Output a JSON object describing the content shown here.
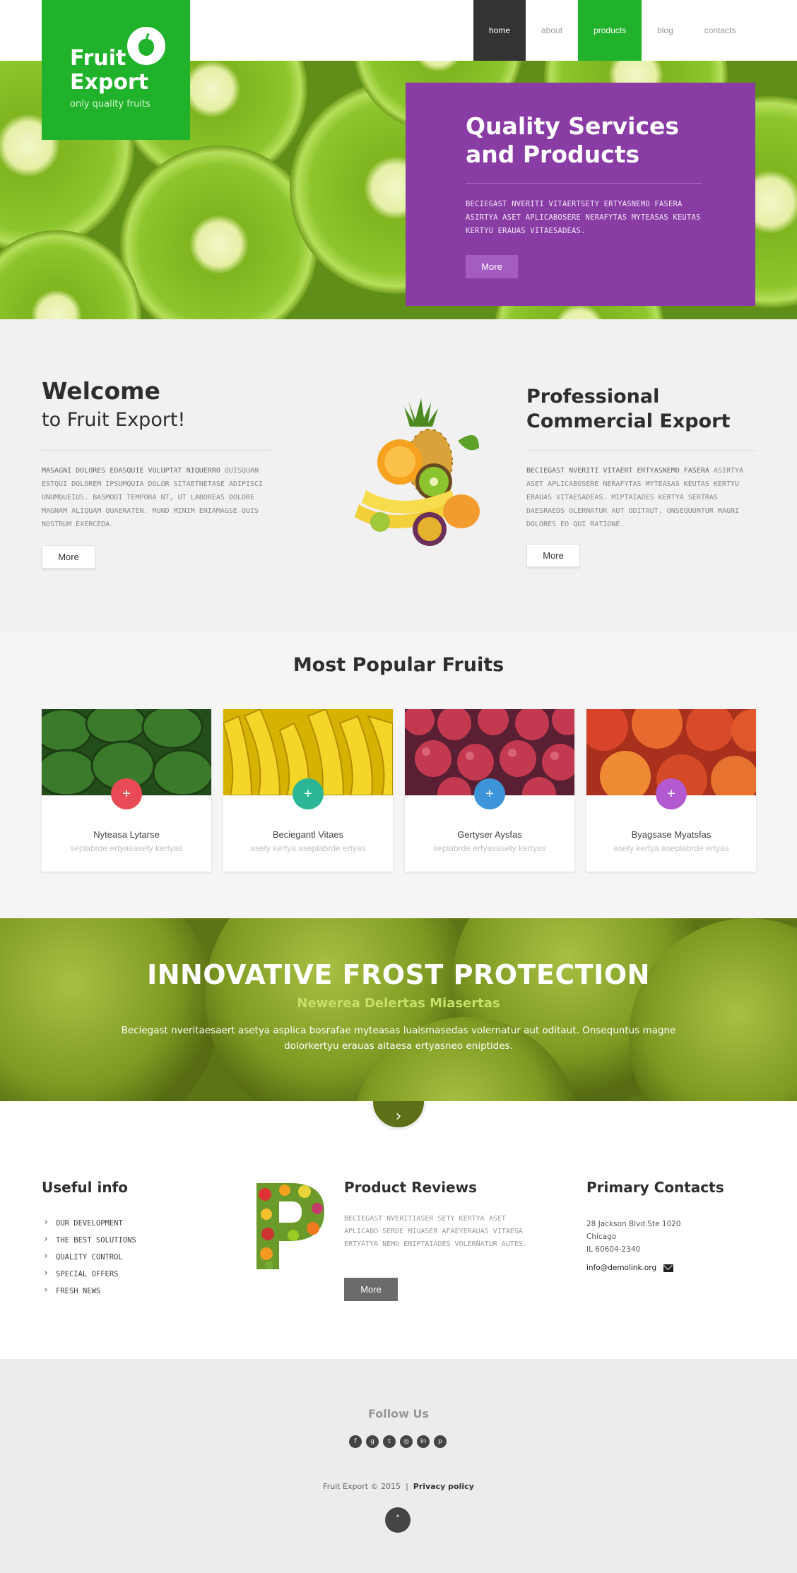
{
  "header": {
    "logo_line1": "Fruit",
    "logo_line2": "Export",
    "logo_tagline": "only quality fruits",
    "nav": [
      "home",
      "about",
      "products",
      "blog",
      "contacts"
    ]
  },
  "hero": {
    "title_line1": "Quality Services",
    "title_line2": "and Products",
    "text": "BECIEGAST NVERITI VITAERTSETY ERTYASNEMO FASERA ASIRTYA ASET APLICABOSERE NERAFYTAS MYTEASAS KEUTAS KERTYU ERAUAS VITAESADEAS.",
    "button": "More"
  },
  "welcome": {
    "title_line1": "Welcome",
    "title_line2": "to Fruit Export!",
    "text_first": "MASAGNI DOLORES EOASQUIE VOLUPTAT NIQUERRO",
    "text_rest": "QUISQUAN ESTQUI DOLOREM IPSUMQUIA DOLOR SITAETNETASE ADIPISCI UNUMQUEIUS. BASMODI TEMPORA NT, UT LABOREAS DOLORE MAGNAM ALIQUAM QUAERATEN. MUND MINIM ENIAMAGSE QUIS NOSTRUM EXERCEDA.",
    "button": "More"
  },
  "professional": {
    "title_line1": "Professional",
    "title_line2": "Commercial Export",
    "text_first": "BECIEGAST NVERITI VITAERT ERTYASNEMO FASERA",
    "text_rest": "ASIRTYA ASET APLICABOSERE NERAFYTAS MYTEASAS KEUTAS KERTYU ERAUAS VITAESADEAS. MIPTAIADES KERTYA SERTRAS DAESRAEDS OLERNATUR AUT ODITAUT. ONSEQUUNTUR MAGNI DOLORES EO QUI RATIONE.",
    "button": "More"
  },
  "popular": {
    "title": "Most Popular Fruits",
    "cards": [
      {
        "name": "Nyteasa Lytarse",
        "sub": "seplabrde ertyasasety kertyas",
        "color": "#e84b55",
        "icon": "plus-icon"
      },
      {
        "name": "Beciegantl Vitaes",
        "sub": "asety kertya aseplabrde ertyas",
        "color": "#2bb796",
        "icon": "plus-icon"
      },
      {
        "name": "Gertyser Aysfas",
        "sub": "seplabrde ertyasasety kertyas",
        "color": "#3d94d8",
        "icon": "plus-icon"
      },
      {
        "name": "Byagsase Myatsfas",
        "sub": "asety kertya aseplabrde ertyas",
        "color": "#b45ad0",
        "icon": "plus-icon"
      }
    ]
  },
  "frost": {
    "title": "INNOVATIVE FROST PROTECTION",
    "subtitle": "Newerea Delertas Miasertas",
    "text": "Beciegast nveritaesaert asetya asplica bosrafae myteasas luaismasedas volernatur aut oditaut. Onsequntus magne dolorkertyu erauas aitaesa ertyasneo eniptides.",
    "arrow": "›"
  },
  "info": {
    "useful_title": "Useful info",
    "links": [
      "OUR DEVELOPMENT",
      "THE BEST SOLUTIONS",
      "QUALITY CONTROL",
      "SPECIAL OFFERS",
      "FRESH NEWS"
    ],
    "reviews_title": "Product Reviews",
    "reviews_text": "BECIEGAST NVERITIASER SETY KERTYA ASET APLICABO SERDE MIUASER AFAEYERAUAS VITAESA ERTYATYA NEMO ENIPTAIADES VOLERNATUR AUTES.",
    "reviews_button": "More",
    "contacts_title": "Primary Contacts",
    "address_line1": "28 Jackson Blvd Ste 1020",
    "address_line2": "Chicago",
    "address_line3": "IL 60604-2340",
    "email": "info@demolink.org"
  },
  "footer": {
    "follow": "Follow Us",
    "socials": [
      {
        "icon": "facebook-icon",
        "glyph": "f"
      },
      {
        "icon": "google-plus-icon",
        "glyph": "g"
      },
      {
        "icon": "twitter-icon",
        "glyph": "t"
      },
      {
        "icon": "instagram-icon",
        "glyph": "◎"
      },
      {
        "icon": "linkedin-icon",
        "glyph": "in"
      },
      {
        "icon": "pinterest-icon",
        "glyph": "p"
      }
    ],
    "copyright": "Fruit Export © 2015",
    "separator": "|",
    "privacy": "Privacy policy",
    "to_top": "˄"
  }
}
